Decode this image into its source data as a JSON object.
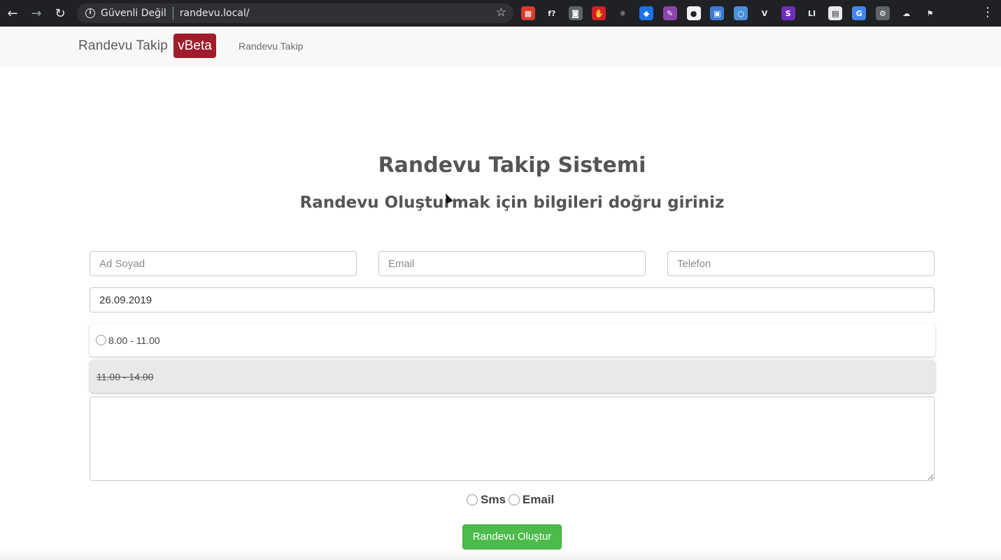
{
  "browser": {
    "security_label": "Güvenli Değil",
    "url": "randevu.local/",
    "extensions": [
      {
        "icon": "red-square-ext-icon",
        "color": "#d93a2b",
        "glyph": "▦"
      },
      {
        "icon": "function-ext-icon",
        "color": "#202124",
        "glyph": "f?"
      },
      {
        "icon": "camera-ext-icon",
        "color": "#5f6368",
        "glyph": "◙"
      },
      {
        "icon": "shield-red-ext-icon",
        "color": "#d71e28",
        "glyph": "✋"
      },
      {
        "icon": "react-ext-icon",
        "color": "#202124",
        "glyph": "⚛"
      },
      {
        "icon": "blue-shield-ext-icon",
        "color": "#1a73e8",
        "glyph": "◆"
      },
      {
        "icon": "purple-pen-ext-icon",
        "color": "#8e44ad",
        "glyph": "✎"
      },
      {
        "icon": "circle-white-ext-icon",
        "color": "#f1f3f4",
        "glyph": "●"
      },
      {
        "icon": "css-ext-icon",
        "color": "#3c7bd4",
        "glyph": "▣"
      },
      {
        "icon": "o-ring-ext-icon",
        "color": "#4a90d9",
        "glyph": "○"
      },
      {
        "icon": "vue-ext-icon",
        "color": "#202124",
        "glyph": "V"
      },
      {
        "icon": "s-ext-icon",
        "color": "#6f2dbd",
        "glyph": "S"
      },
      {
        "icon": "li-ext-icon",
        "color": "#202124",
        "glyph": "LI"
      },
      {
        "icon": "calendar-ext-icon",
        "color": "#e8eaed",
        "glyph": "▤"
      },
      {
        "icon": "translate-ext-icon",
        "color": "#4285f4",
        "glyph": "G"
      },
      {
        "icon": "gear-ext-icon",
        "color": "#5f6368",
        "glyph": "⚙"
      },
      {
        "icon": "cloud-ext-icon",
        "color": "#202124",
        "glyph": "☁"
      },
      {
        "icon": "flag-ext-icon",
        "color": "#202124",
        "glyph": "⚑"
      }
    ]
  },
  "navbar": {
    "brand": "Randevu Takip",
    "badge": "vBeta",
    "link": "Randevu Takip"
  },
  "main": {
    "title": "Randevu Takip Sistemi",
    "subtitle": "Randevu Oluşturmak için bilgileri doğru giriniz"
  },
  "form": {
    "name_placeholder": "Ad Soyad",
    "email_placeholder": "Email",
    "phone_placeholder": "Telefon",
    "date_value": "26.09.2019",
    "slots": [
      {
        "label": "8.00 - 11.00",
        "available": true
      },
      {
        "label": "11.00 - 14.00",
        "available": false
      }
    ],
    "notify_options": [
      "Sms",
      "Email"
    ],
    "submit_label": "Randevu Oluştur"
  },
  "colors": {
    "brand_badge": "#a01c2a",
    "submit_button": "#4cbb4a"
  }
}
